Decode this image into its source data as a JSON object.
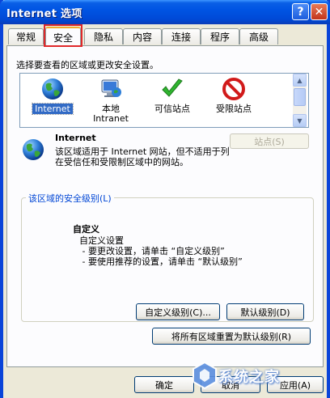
{
  "window": {
    "title": "Internet 选项",
    "help_label": "?",
    "close_label": "✕"
  },
  "tabs": [
    {
      "label": "常规",
      "active": false
    },
    {
      "label": "安全",
      "active": true
    },
    {
      "label": "隐私",
      "active": false
    },
    {
      "label": "内容",
      "active": false
    },
    {
      "label": "连接",
      "active": false
    },
    {
      "label": "程序",
      "active": false
    },
    {
      "label": "高级",
      "active": false
    }
  ],
  "security": {
    "zone_prompt": "选择要查看的区域或更改安全设置。",
    "zones": [
      {
        "label": "Internet",
        "sub": "",
        "icon": "globe-icon",
        "selected": true
      },
      {
        "label": "本地",
        "sub": "Intranet",
        "icon": "monitor-globe-icon",
        "selected": false
      },
      {
        "label": "可信站点",
        "sub": "",
        "icon": "checkmark-icon",
        "selected": false
      },
      {
        "label": "受限站点",
        "sub": "",
        "icon": "prohibited-icon",
        "selected": false
      }
    ],
    "selected_zone": {
      "title": "Internet",
      "description": "该区域适用于 Internet 网站，但不适用于列在受信任和受限制区域中的网站。"
    },
    "sites_button": "站点(S)",
    "level_group_title": "该区域的安全级别(L)",
    "level": {
      "title": "自定义",
      "description_lines": [
        "自定义设置",
        " - 要更改设置，请单击 “自定义级别”",
        " - 要使用推荐的设置，请单击 “默认级别”"
      ]
    },
    "custom_level_button": "自定义级别(C)...",
    "default_level_button": "默认级别(D)",
    "reset_all_button": "将所有区域重置为默认级别(R)"
  },
  "footer": {
    "ok": "确定",
    "cancel": "取消",
    "apply": "应用(A)"
  },
  "watermark": {
    "text": "系统之家"
  },
  "colors": {
    "titlebar": "#0054e3",
    "dialog_bg": "#ece9d8",
    "selection": "#316ac5",
    "group_title": "#0046d5",
    "tab_highlight": "#e0282a"
  }
}
